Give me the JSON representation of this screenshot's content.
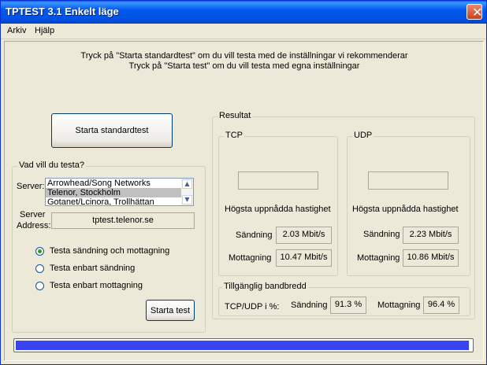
{
  "window": {
    "title": "TPTEST 3.1 Enkelt läge",
    "close_symbol": "✕"
  },
  "menu": [
    "Arkiv",
    "Hjälp"
  ],
  "intro": {
    "line1": "Tryck på \"Starta standardtest\" om du vill testa med de inställningar vi rekommenderar",
    "line2": "Tryck på \"Starta test\" om du vill testa med egna inställningar"
  },
  "standard_button": "Starta standardtest",
  "test_group": {
    "legend": "Vad vill du testa?",
    "server_label": "Server:",
    "servers": [
      "Arrowhead/Song Networks",
      "Telenor, Stockholm",
      "Gotanet/Lcinora, Trollhättan"
    ],
    "selected_server": "Telenor, Stockholm",
    "address_label_1": "Server",
    "address_label_2": "Address:",
    "address_value": "tptest.telenor.se",
    "options": [
      "Testa sändning och mottagning",
      "Testa enbart sändning",
      "Testa enbart mottagning"
    ],
    "selected_option": 0,
    "start_button": "Starta test"
  },
  "result": {
    "legend": "Resultat",
    "tcp": {
      "legend": "TCP",
      "speed_value": "",
      "top_label": "Högsta uppnådda hastighet",
      "send_label": "Sändning",
      "send_value": "2.03 Mbit/s",
      "recv_label": "Mottagning",
      "recv_value": "10.47 Mbit/s"
    },
    "udp": {
      "legend": "UDP",
      "speed_value": "",
      "top_label": "Högsta uppnådda hastighet",
      "send_label": "Sändning",
      "send_value": "2.23 Mbit/s",
      "recv_label": "Mottagning",
      "recv_value": "10.86 Mbit/s"
    },
    "bandwidth": {
      "legend": "Tillgänglig bandbredd",
      "ratio_label": "TCP/UDP i %:",
      "send_label": "Sändning",
      "send_value": "91.3 %",
      "recv_label": "Mottagning",
      "recv_value": "96.4 %"
    }
  },
  "progress": {
    "fraction": 0.995,
    "color": "#3a43f0"
  }
}
